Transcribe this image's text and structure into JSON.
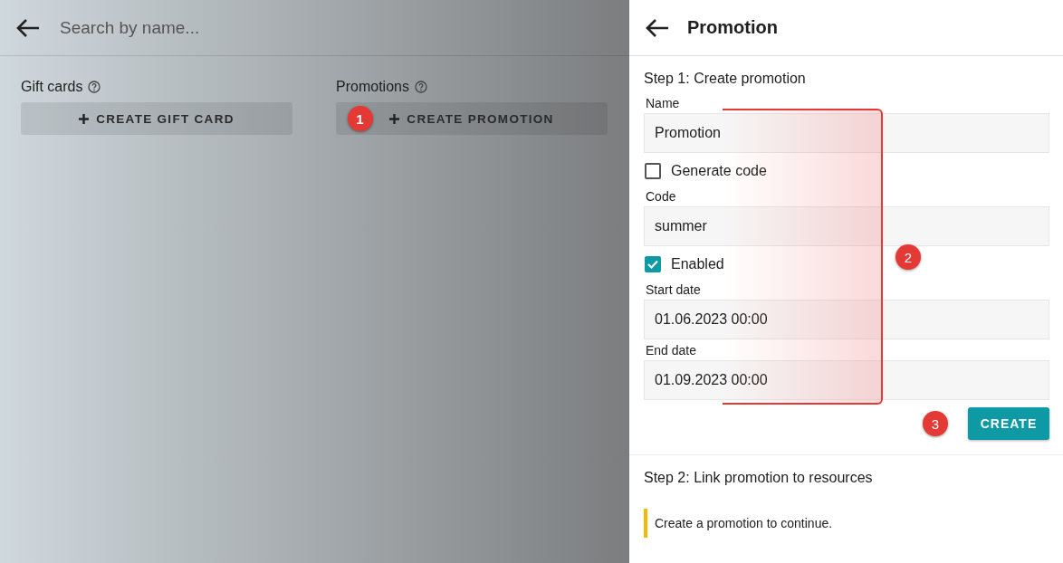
{
  "search": {
    "placeholder": "Search by name..."
  },
  "sections": [
    {
      "title": "Gift cards",
      "button": "CREATE GIFT CARD"
    },
    {
      "title": "Promotions",
      "button": "CREATE PROMOTION"
    }
  ],
  "panel": {
    "title": "Promotion",
    "step1": "Step 1: Create promotion",
    "fields": [
      {
        "kind": "text",
        "label": "Name",
        "value": "Promotion"
      },
      {
        "kind": "checkbox",
        "label": "Generate code",
        "checked": false
      },
      {
        "kind": "text",
        "label": "Code",
        "value": "summer"
      },
      {
        "kind": "checkbox",
        "label": "Enabled",
        "checked": true
      },
      {
        "kind": "text",
        "label": "Start date",
        "value": "01.06.2023 00:00"
      },
      {
        "kind": "text",
        "label": "End date",
        "value": "01.09.2023 00:00"
      }
    ],
    "create_button": "CREATE",
    "step2": "Step 2: Link promotion to resources",
    "notice": "Create a promotion to continue."
  },
  "annotations": [
    {
      "label": "1"
    },
    {
      "label": "2"
    },
    {
      "label": "3"
    }
  ]
}
